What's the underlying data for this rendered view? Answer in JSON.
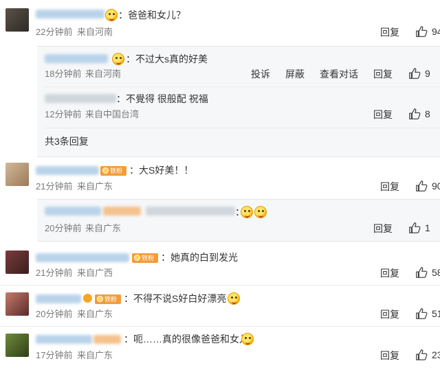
{
  "comments": [
    {
      "text": "：爸爸和女儿？",
      "time": "22分钟前",
      "location": "来自河南",
      "reply_label": "回复",
      "likes": "94"
    },
    {
      "text": "：大S好美！！",
      "time": "21分钟前",
      "location": "来自广东",
      "reply_label": "回复",
      "likes": "90"
    },
    {
      "text": "：她真的白到发光",
      "time": "21分钟前",
      "location": "来自广西",
      "reply_label": "回复",
      "likes": "58"
    },
    {
      "text": "：不得不说S好白好漂亮",
      "time": "20分钟前",
      "location": "来自广东",
      "reply_label": "回复",
      "likes": "51"
    },
    {
      "text": "：呃……真的很像爸爸和女儿",
      "time": "17分钟前",
      "location": "来自广东",
      "reply_label": "回复",
      "likes": "23"
    }
  ],
  "replies": [
    {
      "text": "：不过大s真的好美",
      "time": "18分钟前",
      "location": "来自河南",
      "report_label": "投诉",
      "block_label": "屏蔽",
      "view_conversation_label": "查看对话",
      "reply_label": "回复",
      "likes": "9"
    },
    {
      "text": "：不覺得 很般配 祝福",
      "time": "12分钟前",
      "location": "来自中国台湾",
      "reply_label": "回复",
      "likes": "8"
    },
    {
      "text": "：",
      "time": "20分钟前",
      "location": "来自广东",
      "reply_label": "回复",
      "likes": "1"
    }
  ],
  "more_replies_label": "共3条回复",
  "badge_label": "铁粉",
  "colors": {
    "accent": "#f39c3a",
    "reply_bg": "#f6f7f9",
    "meta": "#7a7a7a"
  }
}
